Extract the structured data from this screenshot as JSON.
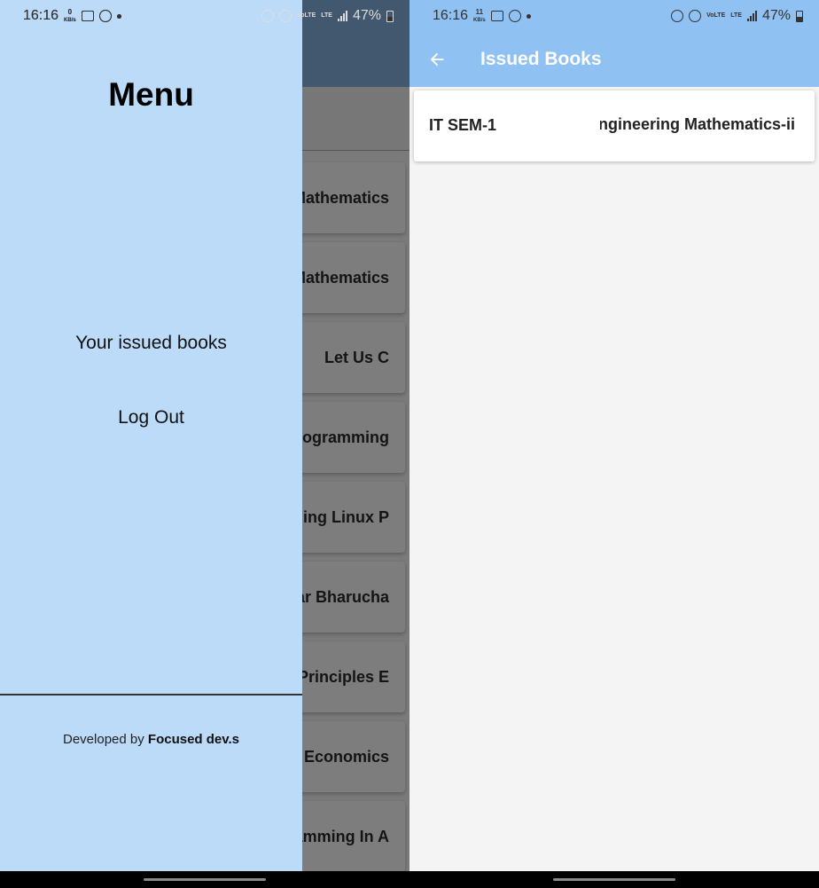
{
  "left_status": {
    "time": "16:16",
    "speed_value": "0",
    "speed_unit": "KB/s",
    "volte": "VoLTE",
    "lte": "LTE",
    "battery": "47%"
  },
  "right_status": {
    "time": "16:16",
    "speed_value": "11",
    "speed_unit": "KB/s",
    "volte": "VoLTE",
    "lte": "LTE",
    "battery": "47%"
  },
  "drawer": {
    "title": "Menu",
    "items": [
      "Your issued books",
      "Log Out"
    ],
    "credit_prefix": "Developed by ",
    "credit_name": "Focused dev.s"
  },
  "background_books": [
    "Engineering Mathematics",
    "Engineering Mathematics",
    "Let Us C",
    "Programming",
    "Shell Programming   Linux P",
    "Dilip Kumar Bharucha",
    "Accounting Principles   E",
    "Economics",
    "Programming In A"
  ],
  "issued_screen": {
    "title": "Issued Books",
    "issued": [
      {
        "semester": "IT SEM-1",
        "book": "Engineering Mathematics-ii"
      }
    ]
  },
  "colors": {
    "drawer_bg": "#bbdbf8",
    "appbar_bg": "#90c1f3",
    "scrim_appbar": "#41586f"
  }
}
